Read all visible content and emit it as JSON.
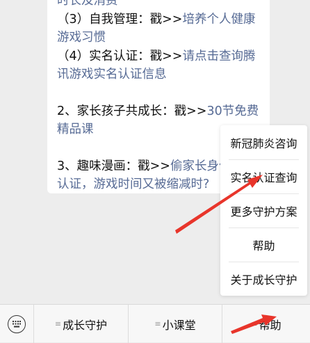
{
  "message": {
    "line_0": "时长及消费",
    "item3_prefix": "（3）自我管理：戳>>",
    "item3_link": "培养个人健康游戏习惯",
    "item4_prefix": "（4）实名认证：戳>>",
    "item4_link": "请点击查询腾讯游戏实名认证信息",
    "item2_prefix": "2、家长孩子共成长：戳>>",
    "item2_link": "30节免费精品课",
    "item3b_prefix": "3、趣味漫画：戳>>",
    "item3b_link": "偷家长身份实名认证，游戏时间又被缩减时?"
  },
  "tabbar": {
    "keyboard_icon": "keyboard-icon",
    "tabs": [
      {
        "label": "成长守护"
      },
      {
        "label": "小课堂"
      },
      {
        "label": "帮助"
      }
    ]
  },
  "popup_menu": {
    "items": [
      {
        "label": "新冠肺炎咨询"
      },
      {
        "label": "实名认证查询"
      },
      {
        "label": "更多守护方案"
      },
      {
        "label": "帮助"
      },
      {
        "label": "关于成长守护"
      }
    ]
  },
  "colors": {
    "link": "#576b95",
    "annotation_arrow": "#e8352b",
    "background": "#ededed"
  }
}
